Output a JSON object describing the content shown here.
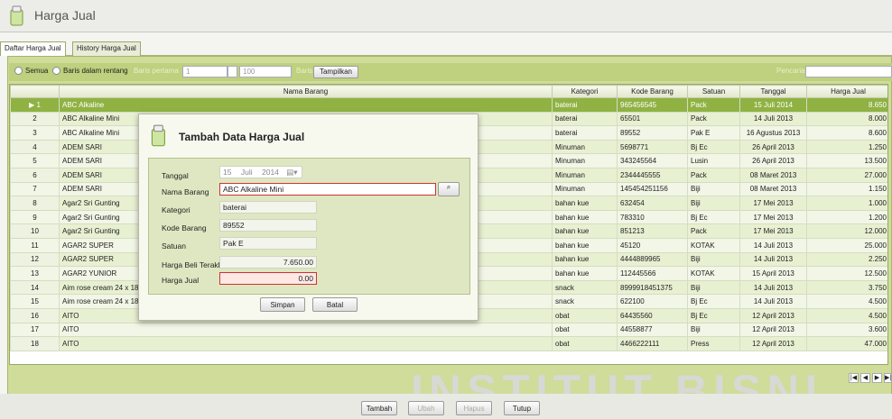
{
  "app": {
    "title": "Harga Jual",
    "tabs": [
      "Daftar Harga Jual",
      "History Harga Jual"
    ]
  },
  "filter": {
    "radio_all": "Semua",
    "radio_range": "Baris dalam rentang",
    "first_row_label": "Baris pertama",
    "first_row_value": "1",
    "count_value": "100",
    "rows_label": "Baris",
    "show_button": "Tampilkan",
    "search_label": "Pencarian"
  },
  "table": {
    "columns": [
      "",
      "Nama Barang",
      "Kategori",
      "Kode Barang",
      "Satuan",
      "Tanggal",
      "Harga Jual"
    ],
    "rows": [
      [
        "1",
        "ABC Alkaline",
        "baterai",
        "965456545",
        "Pack",
        "15 Juli 2014",
        "8.650"
      ],
      [
        "2",
        "ABC Alkaline Mini",
        "baterai",
        "65501",
        "Pack",
        "14 Juli 2013",
        "8.000"
      ],
      [
        "3",
        "ABC Alkaline Mini",
        "baterai",
        "89552",
        "Pak E",
        "16 Agustus 2013",
        "8.600"
      ],
      [
        "4",
        "ADEM SARI",
        "Minuman",
        "5698771",
        "Bj Ec",
        "26 April 2013",
        "1.250"
      ],
      [
        "5",
        "ADEM SARI",
        "Minuman",
        "343245564",
        "Lusin",
        "26 April 2013",
        "13.500"
      ],
      [
        "6",
        "ADEM SARI",
        "Minuman",
        "2344445555",
        "Pack",
        "08 Maret 2013",
        "27.000"
      ],
      [
        "7",
        "ADEM SARI",
        "Minuman",
        "145454251156",
        "Biji",
        "08 Maret 2013",
        "1.150"
      ],
      [
        "8",
        "Agar2 Sri Gunting",
        "bahan kue",
        "632454",
        "Biji",
        "17 Mei 2013",
        "1.000"
      ],
      [
        "9",
        "Agar2 Sri Gunting",
        "bahan kue",
        "783310",
        "Bj Ec",
        "17 Mei 2013",
        "1.200"
      ],
      [
        "10",
        "Agar2 Sri Gunting",
        "bahan kue",
        "851213",
        "Pack",
        "17 Mei 2013",
        "12.000"
      ],
      [
        "11",
        "AGAR2 SUPER",
        "bahan kue",
        "45120",
        "KOTAK",
        "14 Juli 2013",
        "25.000"
      ],
      [
        "12",
        "AGAR2 SUPER",
        "bahan kue",
        "4444889965",
        "Biji",
        "14 Juli 2013",
        "2.250"
      ],
      [
        "13",
        "AGAR2 YUNIOR",
        "bahan kue",
        "112445566",
        "KOTAK",
        "15 April 2013",
        "12.500"
      ],
      [
        "14",
        "Aim rose cream 24 x 180",
        "snack",
        "8999918451375",
        "Biji",
        "14 Juli 2013",
        "3.750"
      ],
      [
        "15",
        "Aim rose cream 24 x 180",
        "snack",
        "622100",
        "Bj Ec",
        "14 Juli 2013",
        "4.500"
      ],
      [
        "16",
        "AITO",
        "obat",
        "64435560",
        "Bj Ec",
        "12 April 2013",
        "4.500"
      ],
      [
        "17",
        "AITO",
        "obat",
        "44558877",
        "Biji",
        "12 April 2013",
        "3.600"
      ],
      [
        "18",
        "AITO",
        "obat",
        "4466222111",
        "Press",
        "12 April 2013",
        "47.000"
      ]
    ]
  },
  "bottom_buttons": [
    "Tambah",
    "Ubah",
    "Hapus",
    "Tutup"
  ],
  "watermark": "INSTITUT BISNI",
  "dialog": {
    "title": "Tambah Data Harga Jual",
    "tanggal_label": "Tanggal",
    "tanggal_day": "15",
    "tanggal_month": "Juli",
    "tanggal_year": "2014",
    "nama_label": "Nama Barang",
    "nama_value": "ABC Alkaline Mini",
    "kategori_label": "Kategori",
    "kategori_value": "baterai",
    "kode_label": "Kode Barang",
    "kode_value": "89552",
    "satuan_label": "Satuan",
    "satuan_value": "Pak E",
    "hbeli_label": "Harga Beli Terakhir",
    "hbeli_value": "7.650.00",
    "hjual_label": "Harga Jual",
    "hjual_value": "0.00",
    "save_button": "Simpan",
    "cancel_button": "Batal"
  },
  "colors": {
    "accent_green": "#8fb243",
    "panel_green": "#cfdc9a",
    "error_red": "#cc3333"
  }
}
